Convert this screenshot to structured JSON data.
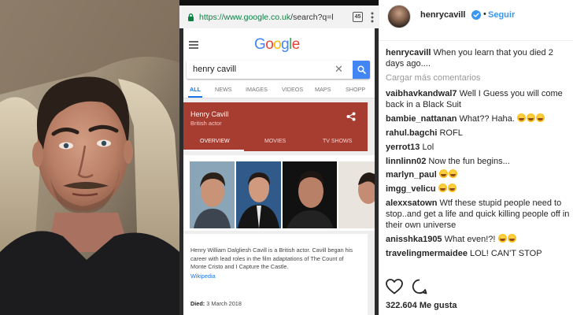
{
  "browser": {
    "url_host": "https://www.google.co.uk",
    "url_path": "/search?q=l",
    "tab_count": "45"
  },
  "google": {
    "logo_text": "Google",
    "search_query": "henry cavill",
    "tabs": [
      "ALL",
      "NEWS",
      "IMAGES",
      "VIDEOS",
      "MAPS",
      "SHOPP"
    ],
    "active_tab": "ALL",
    "knowledge_panel": {
      "name": "Henry Cavill",
      "subtitle": "British actor",
      "tabs": [
        "OVERVIEW",
        "MOVIES",
        "TV SHOWS"
      ],
      "active_tab": "OVERVIEW",
      "header_color": "#a73c30",
      "description": "Henry William Dalgliesh Cavill is a British actor. Cavill began his career with lead roles in the film adaptations of The Count of Monte Cristo and I Capture the Castle.",
      "source_link": "Wikipedia",
      "died_label": "Died:",
      "died_value": "3 March 2018"
    }
  },
  "instagram": {
    "username": "henrycavill",
    "separator": "•",
    "follow_label": "Seguir",
    "caption": {
      "user": "henrycavill",
      "text": "When you learn that you died 2 days ago...."
    },
    "load_more": "Cargar más comentarios",
    "comments": [
      {
        "user": "vaibhavkandwal7",
        "text": "Well I Guess you will come back in a Black Suit",
        "emoji": 0
      },
      {
        "user": "bambie_nattanan",
        "text": "What?? Haha.",
        "emoji": 3
      },
      {
        "user": "rahul.bagchi",
        "text": "ROFL",
        "emoji": 0
      },
      {
        "user": "yerrot13",
        "text": "Lol",
        "emoji": 0
      },
      {
        "user": "linnlinn02",
        "text": "Now the fun begins...",
        "emoji": 0
      },
      {
        "user": "marlyn_paul",
        "text": "",
        "emoji": 2
      },
      {
        "user": "imgg_velicu",
        "text": "",
        "emoji": 2
      },
      {
        "user": "alexxsatown",
        "text": "Wtf these stupid people need to stop..and get a life and quick killing people off in their own universe",
        "emoji": 0
      },
      {
        "user": "anisshka1905",
        "text": "What even!?!",
        "emoji": 2
      },
      {
        "user": "travelingmermaidee",
        "text": "LOL! CAN'T STOP",
        "emoji": 0
      }
    ],
    "likes": "322.604 Me gusta",
    "accent_color": "#3897f0"
  }
}
